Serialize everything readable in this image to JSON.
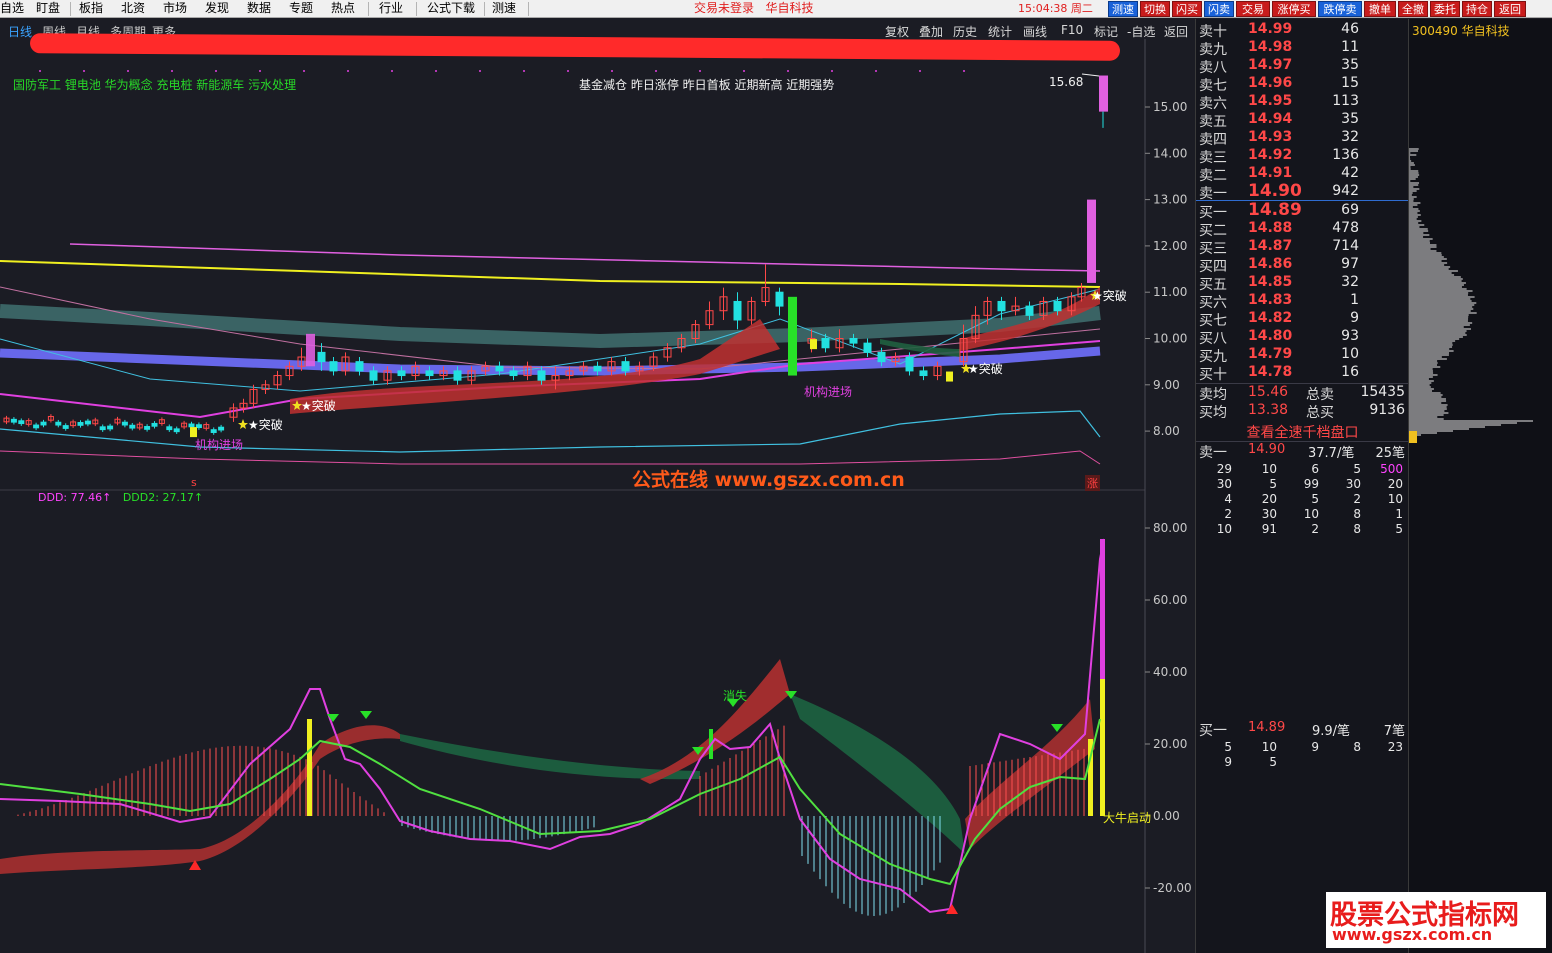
{
  "menubar": {
    "items": [
      "自选",
      "盯盘",
      "板指",
      "北资",
      "市场",
      "发现",
      "数据",
      "专题",
      "热点",
      "行业",
      "公式下载",
      "测速"
    ],
    "login_status": "交易未登录",
    "broker": "华自科技",
    "clock": "15:04:38 周二",
    "quick_buttons": [
      "测速",
      "切换",
      "闪买",
      "闪卖",
      "交易",
      "涨停买",
      "跌停卖",
      "撤单",
      "全撤",
      "委托",
      "持仓",
      "返回"
    ]
  },
  "chart_header": {
    "period_tabs": [
      "日线",
      "周线",
      "月线",
      "多周期",
      "更多"
    ],
    "active_period": "日线",
    "toolbar": [
      "复权",
      "叠加",
      "历史",
      "统计",
      "画线",
      "F10",
      "标记",
      "-自选",
      "返回"
    ]
  },
  "concepts": {
    "left": "国防军工 锂电池 华为概念 充电桩 新能源车 污水处理",
    "mid": "基金减仓 昨日涨停 昨日首板 近期新高 近期强势"
  },
  "price_axis": [
    "15.00",
    "14.00",
    "13.00",
    "12.00",
    "11.00",
    "10.00",
    "9.00",
    "8.00"
  ],
  "indicator_axis": [
    "80.00",
    "60.00",
    "40.00",
    "20.00",
    "0.00",
    "-20.00"
  ],
  "max_price_label": "15.68",
  "indicator_legend": {
    "ddd": "DDD: 77.46↑",
    "ddd2": "DDD2: 27.17↑"
  },
  "signals": {
    "breakout": "★突破",
    "institution": "机构进场",
    "vanish": "消失",
    "bull_start": "大牛启动",
    "bottom_s": "s",
    "zhang": "涨"
  },
  "watermark_center": "公式在线 www.gszx.com.cn",
  "order_book": {
    "asks": [
      {
        "label": "卖十",
        "price": "14.99",
        "vol": "46"
      },
      {
        "label": "卖九",
        "price": "14.98",
        "vol": "11"
      },
      {
        "label": "卖八",
        "price": "14.97",
        "vol": "35"
      },
      {
        "label": "卖七",
        "price": "14.96",
        "vol": "15"
      },
      {
        "label": "卖六",
        "price": "14.95",
        "vol": "113"
      },
      {
        "label": "卖五",
        "price": "14.94",
        "vol": "35"
      },
      {
        "label": "卖四",
        "price": "14.93",
        "vol": "32"
      },
      {
        "label": "卖三",
        "price": "14.92",
        "vol": "136"
      },
      {
        "label": "卖二",
        "price": "14.91",
        "vol": "42"
      },
      {
        "label": "卖一",
        "price": "14.90",
        "vol": "942"
      }
    ],
    "bids": [
      {
        "label": "买一",
        "price": "14.89",
        "vol": "69"
      },
      {
        "label": "买二",
        "price": "14.88",
        "vol": "478"
      },
      {
        "label": "买三",
        "price": "14.87",
        "vol": "714"
      },
      {
        "label": "买四",
        "price": "14.86",
        "vol": "97"
      },
      {
        "label": "买五",
        "price": "14.85",
        "vol": "32"
      },
      {
        "label": "买六",
        "price": "14.83",
        "vol": "1"
      },
      {
        "label": "买七",
        "price": "14.82",
        "vol": "9"
      },
      {
        "label": "买八",
        "price": "14.80",
        "vol": "93"
      },
      {
        "label": "买九",
        "price": "14.79",
        "vol": "10"
      },
      {
        "label": "买十",
        "price": "14.78",
        "vol": "16"
      }
    ],
    "avg_sell_label": "卖均",
    "avg_sell": "15.46",
    "total_sell_label": "总卖",
    "total_sell": "15435",
    "avg_buy_label": "买均",
    "avg_buy": "13.38",
    "total_buy_label": "总买",
    "total_buy": "9136",
    "view_all": "查看全速千档盘口",
    "ask1_detail": {
      "label": "卖一",
      "price": "14.90",
      "per": "37.7/笔",
      "count": "25笔"
    },
    "ask1_queue": [
      [
        "29",
        "10",
        "6",
        "5",
        "500"
      ],
      [
        "30",
        "5",
        "99",
        "30",
        "20"
      ],
      [
        "4",
        "20",
        "5",
        "2",
        "10"
      ],
      [
        "2",
        "30",
        "10",
        "8",
        "1"
      ],
      [
        "10",
        "91",
        "2",
        "8",
        "5"
      ]
    ],
    "bid1_detail": {
      "label": "买一",
      "price": "14.89",
      "per": "9.9/笔",
      "count": "7笔"
    },
    "bid1_queue": [
      [
        "5",
        "10",
        "9",
        "8",
        "23"
      ],
      [
        "9",
        "5",
        "",
        "",
        ""
      ]
    ]
  },
  "depth": {
    "title": "300490 华自科技"
  },
  "watermark_box": {
    "line1": "股票公式指标网",
    "line2": "www.gszx.com.cn"
  },
  "colors": {
    "up": "#ff4848",
    "down": "#22e0e0",
    "accent": "#3aa3ff",
    "magenta": "#ff44ff",
    "green": "#28e028"
  }
}
